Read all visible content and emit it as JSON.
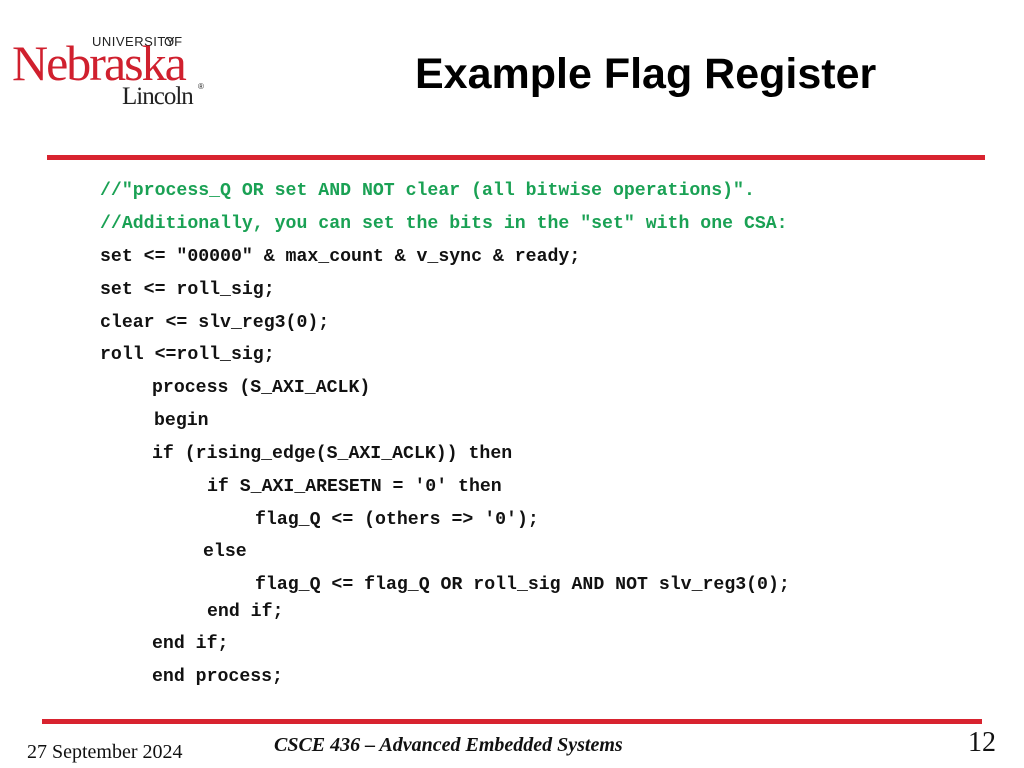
{
  "logo": {
    "university": "UNIVERSITY",
    "of": "OF",
    "name": "Nebraska",
    "campus": "Lincoln",
    "registered": "®",
    "colors": {
      "red": "#d0202e",
      "dark": "#222222"
    }
  },
  "slide": {
    "title": "Example Flag Register",
    "accent_color": "#d8232f",
    "comment_color": "#1aa154"
  },
  "code": {
    "lines": [
      {
        "text": "//\"process_Q OR set AND NOT clear (all bitwise operations)\".",
        "type": "comment",
        "indent": 0
      },
      {
        "text": "//Additionally, you can set the bits in the \"set\" with one CSA:",
        "type": "comment",
        "indent": 0
      },
      {
        "text": "set <= \"00000\" & max_count & v_sync & ready;",
        "type": "code",
        "indent": 0
      },
      {
        "text": "set <= roll_sig;",
        "type": "code",
        "indent": 0
      },
      {
        "text": "clear <= slv_reg3(0);",
        "type": "code",
        "indent": 0
      },
      {
        "text": "roll <=roll_sig;",
        "type": "code",
        "indent": 0
      },
      {
        "text": "process (S_AXI_ACLK)",
        "type": "code",
        "indent": 1
      },
      {
        "text": "begin",
        "type": "code",
        "indent": 1
      },
      {
        "text": "if (rising_edge(S_AXI_ACLK)) then",
        "type": "code",
        "indent": 1
      },
      {
        "text": "if S_AXI_ARESETN = '0' then",
        "type": "code",
        "indent": 2
      },
      {
        "text": "flag_Q <= (others => '0');",
        "type": "code",
        "indent": 3
      },
      {
        "text": "else",
        "type": "code",
        "indent": 2
      },
      {
        "text": "flag_Q <= flag_Q OR roll_sig AND NOT slv_reg3(0);",
        "type": "code",
        "indent": 3
      },
      {
        "text": "end if;",
        "type": "code",
        "indent": 2
      },
      {
        "text": "end if;",
        "type": "code",
        "indent": 1
      },
      {
        "text": "end process;",
        "type": "code",
        "indent": 1
      }
    ]
  },
  "footer": {
    "date": "27 September 2024",
    "course": "CSCE 436 – Advanced Embedded Systems",
    "page_number": "12"
  }
}
